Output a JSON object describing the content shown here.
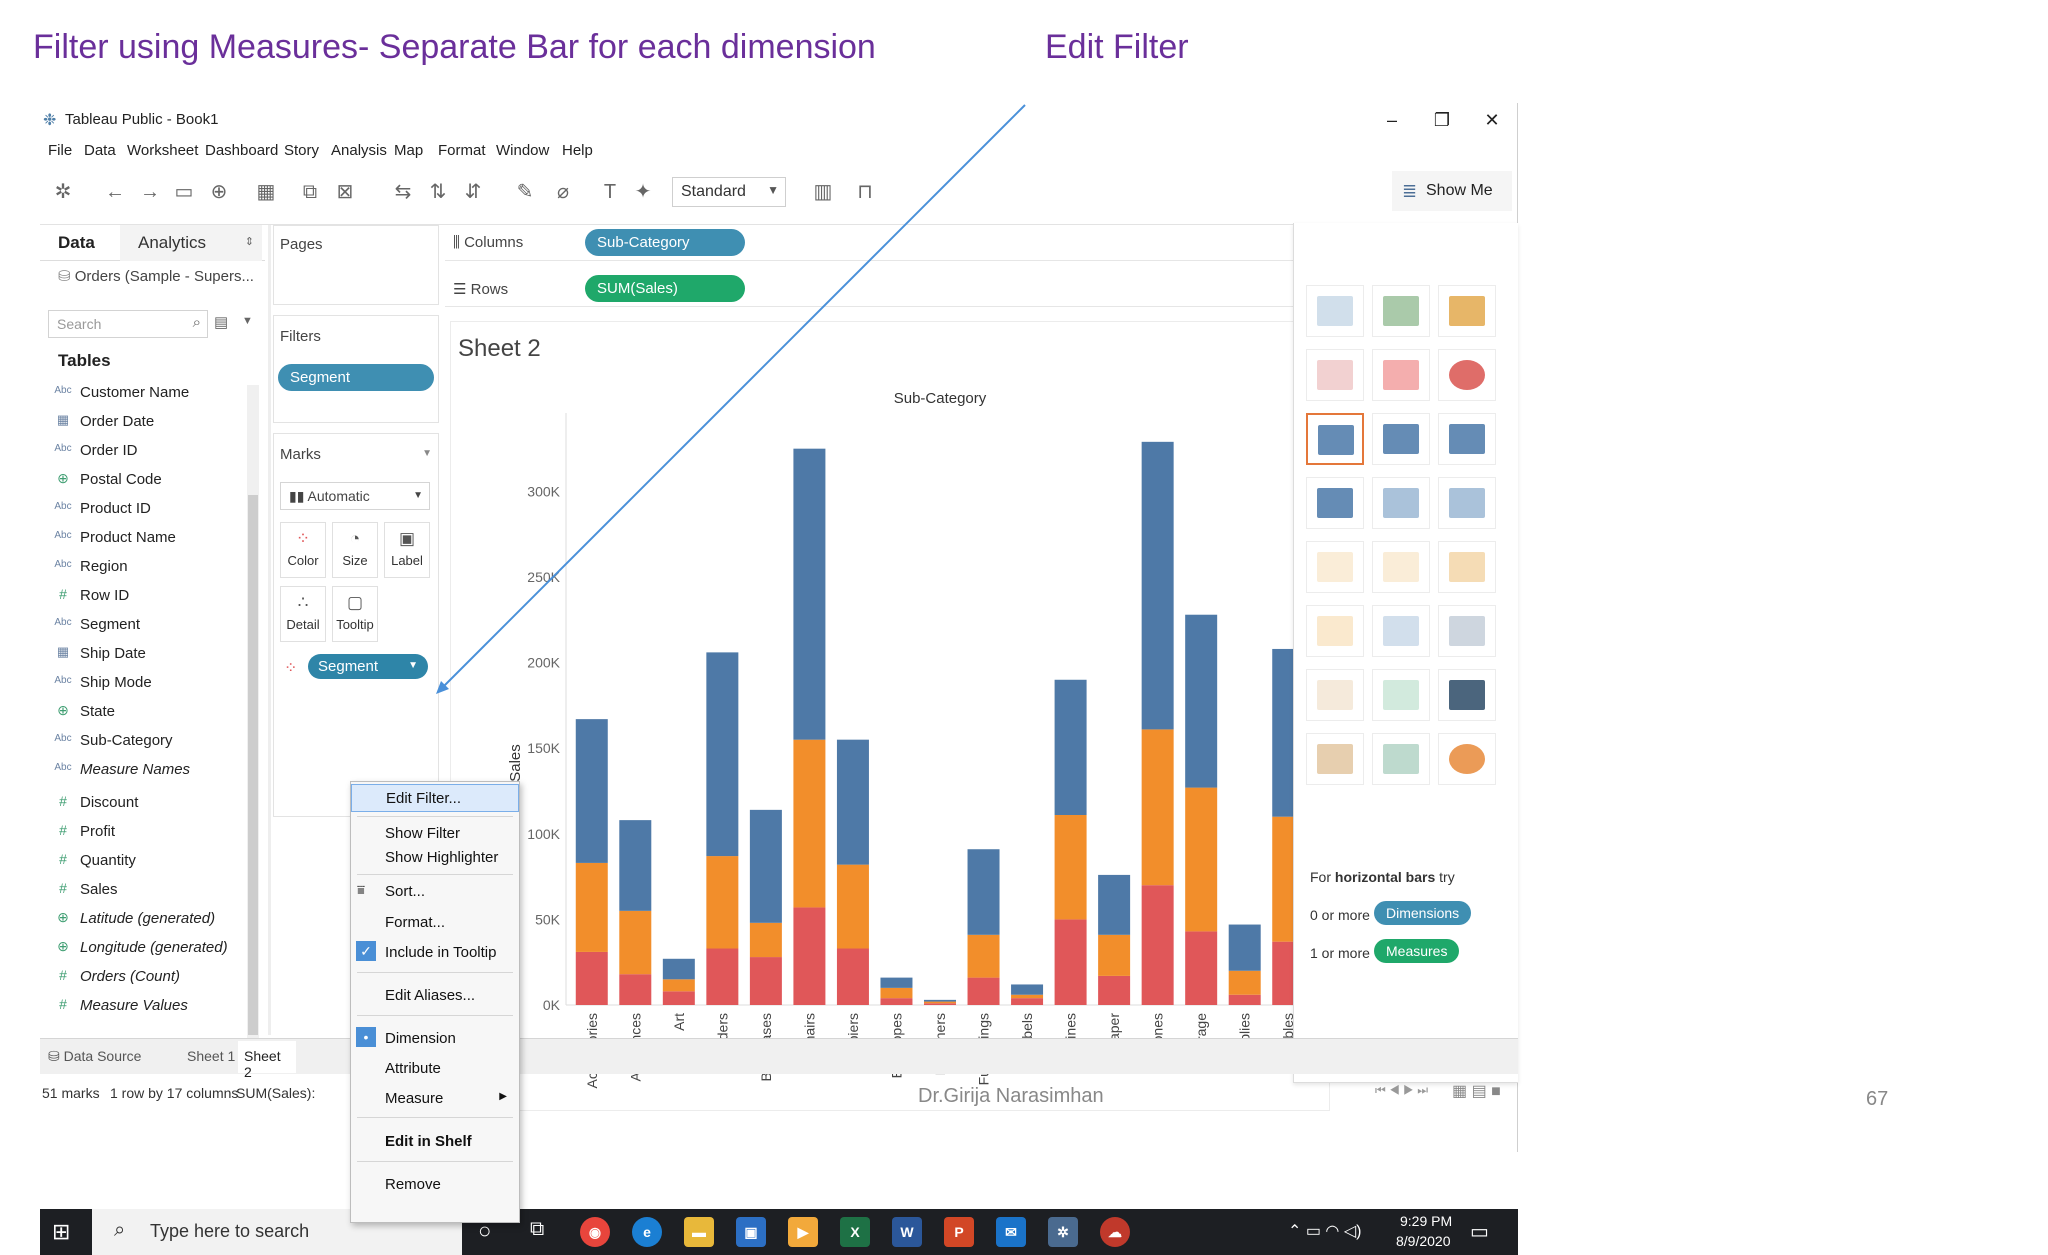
{
  "slide": {
    "title": "Filter using Measures- Separate Bar for each dimension",
    "annotation": "Edit Filter",
    "author": "Dr.Girija Narasimhan",
    "page_number": "67"
  },
  "window": {
    "title": "Tableau Public - Book1",
    "controls": [
      "–",
      "❐",
      "✕"
    ]
  },
  "menubar": [
    "File",
    "Data",
    "Worksheet",
    "Dashboard",
    "Story",
    "Analysis",
    "Map",
    "Format",
    "Window",
    "Help"
  ],
  "toolbar": {
    "view_mode": "Standard",
    "show_me_label": "Show Me"
  },
  "data_pane": {
    "tab_data": "Data",
    "tab_analytics": "Analytics",
    "datasource": "Orders (Sample - Supers...",
    "search_placeholder": "Search",
    "tables_header": "Tables",
    "fields": [
      {
        "type": "Abc",
        "name": "Customer Name"
      },
      {
        "type": "cal",
        "name": "Order Date"
      },
      {
        "type": "Abc",
        "name": "Order ID"
      },
      {
        "type": "geo",
        "name": "Postal Code"
      },
      {
        "type": "Abc",
        "name": "Product ID"
      },
      {
        "type": "Abc",
        "name": "Product Name"
      },
      {
        "type": "Abc",
        "name": "Region"
      },
      {
        "type": "#",
        "name": "Row ID"
      },
      {
        "type": "Abc",
        "name": "Segment"
      },
      {
        "type": "cal",
        "name": "Ship Date"
      },
      {
        "type": "Abc",
        "name": "Ship Mode"
      },
      {
        "type": "geo",
        "name": "State"
      },
      {
        "type": "Abc",
        "name": "Sub-Category"
      },
      {
        "type": "Abc",
        "name": "Measure Names"
      },
      {
        "type": "#",
        "name": "Discount"
      },
      {
        "type": "#",
        "name": "Profit"
      },
      {
        "type": "#",
        "name": "Quantity"
      },
      {
        "type": "#",
        "name": "Sales"
      },
      {
        "type": "geo",
        "name": "Latitude (generated)"
      },
      {
        "type": "geo",
        "name": "Longitude (generated)"
      },
      {
        "type": "#",
        "name": "Orders (Count)"
      },
      {
        "type": "#",
        "name": "Measure Values"
      }
    ]
  },
  "shelves": {
    "pages_label": "Pages",
    "filters_label": "Filters",
    "filter_pill": "Segment",
    "columns_label": "Columns",
    "columns_pill": "Sub-Category",
    "rows_label": "Rows",
    "rows_pill": "SUM(Sales)"
  },
  "marks": {
    "title": "Marks",
    "mark_type": "Automatic",
    "cards": [
      "Color",
      "Size",
      "Label",
      "Detail",
      "Tooltip"
    ],
    "color_pill": "Segment"
  },
  "context_menu": {
    "items": [
      "Edit Filter...",
      "Show Filter",
      "Show Highlighter",
      "Sort...",
      "Format...",
      "Include in Tooltip",
      "Edit Aliases...",
      "Dimension",
      "Attribute",
      "Measure",
      "Edit in Shelf",
      "Remove"
    ]
  },
  "sheet": {
    "title": "Sheet 2",
    "column_header": "Sub-Category",
    "y_axis_label": "Sales"
  },
  "chart_data": {
    "type": "bar",
    "stacked": true,
    "title": "Sheet 2",
    "xlabel": "Sub-Category",
    "ylabel": "Sales",
    "ylim": [
      0,
      340000
    ],
    "y_ticks": [
      "0K",
      "50K",
      "100K",
      "150K",
      "200K",
      "250K",
      "300K"
    ],
    "categories": [
      "Accessories",
      "Appliances",
      "Art",
      "Binders",
      "Bookcases",
      "Chairs",
      "Copiers",
      "Envelopes",
      "Fasteners",
      "Furnishings",
      "Labels",
      "Machines",
      "Paper",
      "Phones",
      "Storage",
      "Supplies",
      "Tables"
    ],
    "series": [
      {
        "color": "#e05759",
        "values": [
          31000,
          18000,
          8000,
          33000,
          28000,
          57000,
          33000,
          4000,
          1000,
          16000,
          4000,
          50000,
          17000,
          70000,
          43000,
          6000,
          37000
        ]
      },
      {
        "color": "#f28e2b",
        "values": [
          52000,
          37000,
          7000,
          54000,
          20000,
          98000,
          49000,
          6000,
          1000,
          25000,
          2000,
          61000,
          24000,
          91000,
          84000,
          14000,
          73000
        ]
      },
      {
        "color": "#4e79a7",
        "values": [
          84000,
          53000,
          12000,
          119000,
          66000,
          170000,
          73000,
          6000,
          1000,
          50000,
          6000,
          79000,
          35000,
          168000,
          101000,
          27000,
          98000
        ]
      }
    ]
  },
  "show_me": {
    "hint_prefix": "For ",
    "hint_bold": "horizontal bars",
    "hint_suffix": " try",
    "dims_prefix": "0 or more",
    "dims_pill": "Dimensions",
    "meas_prefix": "1 or more",
    "meas_pill": "Measures"
  },
  "bottom_tabs": {
    "datasource": "Data Source",
    "sheet1": "Sheet 1",
    "sheet2": "Sheet 2"
  },
  "status": {
    "marks": "51 marks",
    "rows_cols": "1 row by 17 columns",
    "sum": "SUM(Sales):"
  },
  "taskbar": {
    "search_placeholder": "Type here to search",
    "time": "9:29 PM",
    "date": "8/9/2020"
  }
}
